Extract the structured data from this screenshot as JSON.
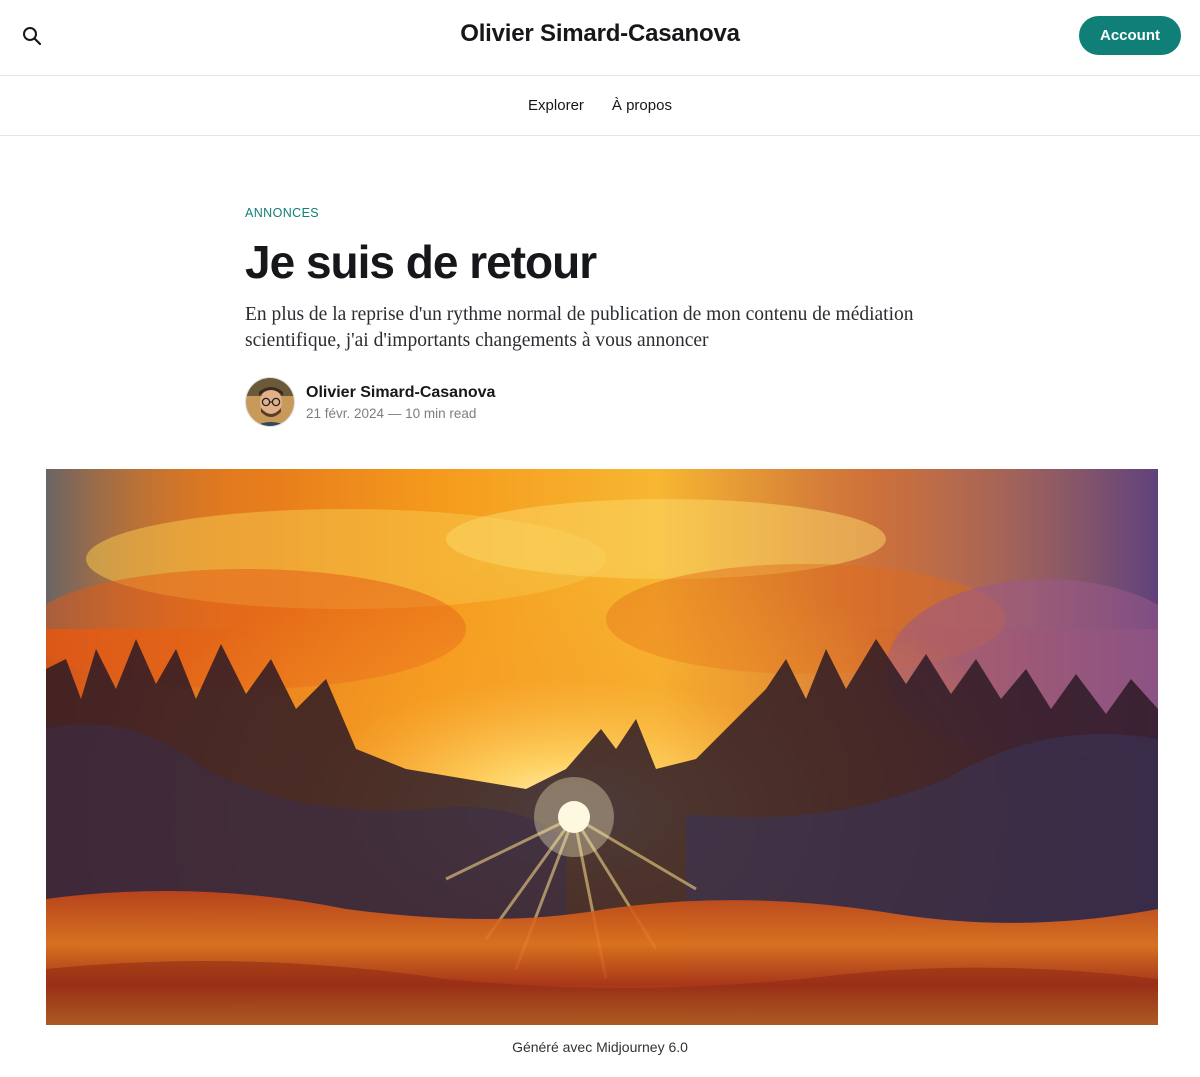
{
  "header": {
    "site_title": "Olivier Simard-Casanova",
    "account_label": "Account",
    "search_icon": "search-icon",
    "accent_color": "#0f7f78"
  },
  "nav": {
    "items": [
      {
        "label": "Explorer"
      },
      {
        "label": "À propos"
      }
    ]
  },
  "article": {
    "tag": "ANNONCES",
    "title": "Je suis de retour",
    "excerpt": "En plus de la reprise d'un rythme normal de publication de mon contenu de médiation scientifique, j'ai d'importants changements à vous annoncer",
    "author": "Olivier Simard-Casanova",
    "date": "21 févr. 2024",
    "separator": "—",
    "read_time": "10 min read",
    "image_caption": "Généré avec Midjourney 6.0"
  }
}
